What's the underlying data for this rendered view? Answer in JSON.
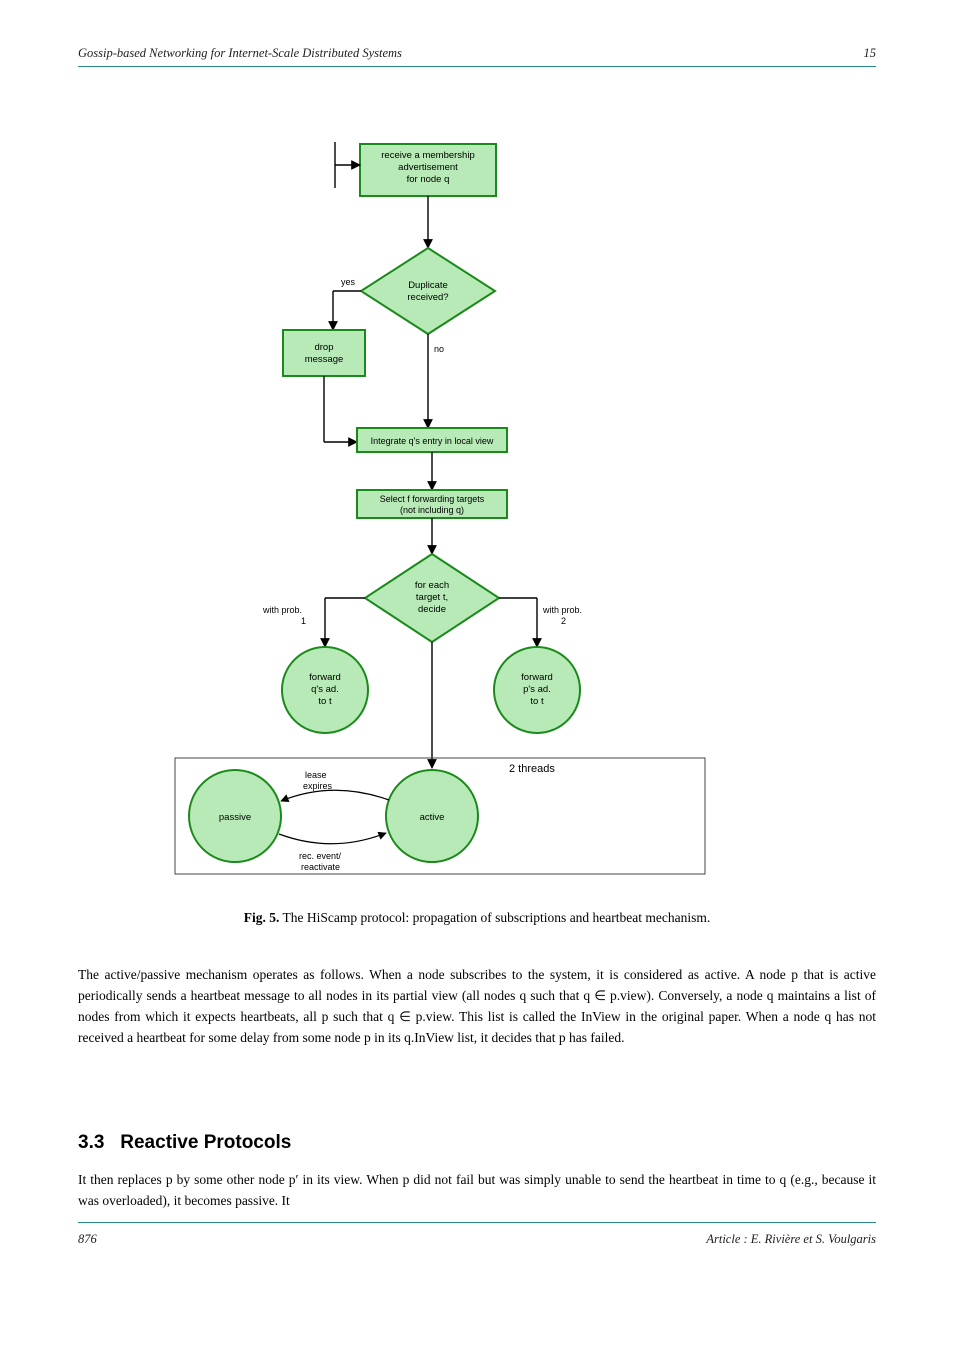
{
  "header": {
    "left": "Gossip-based Networking for Internet-Scale Distributed Systems",
    "right": "15"
  },
  "footer": {
    "left": "876",
    "right": "Article : E. Rivière et S. Voulgaris"
  },
  "figure": {
    "nodes": {
      "receive": "receive a membership\nadvertisement\nfor node q",
      "dup": "Duplicate\nreceived?",
      "drop": "drop\nmessage",
      "integrate": "Integrate q's entry in local view",
      "select": "Select f forwarding targets\n(not including q)",
      "decide": "for each\ntarget t,\ndecide",
      "fwd_q_1": "forward\nq's ad.\nto t",
      "fwd_p": "forward\np's ad.\nto t",
      "active": "active",
      "passive": "passive"
    },
    "edge_labels": {
      "dup_yes": "yes",
      "dup_no": "no",
      "prob1": "with prob.\n1",
      "prob2": "with prob.\n2",
      "threads": "2 threads",
      "lease": "lease\nexpires",
      "event": "rec. event/\nreactivate"
    },
    "caption": "Fig. 5. The HiScamp protocol: propagation of subscriptions and heartbeat mechanism."
  },
  "body": {
    "p1": "The active/passive mechanism operates as follows. When a node subscribes to the system, it is considered as active. A node p that is active periodically sends a heartbeat message to all nodes in its partial view (all nodes q such that q ∈ p.view). Conversely, a node q maintains a list of nodes from which it expects heartbeats, all p such that q ∈ p.view. This list is called the InView in the original paper. When a node q has not received a heartbeat for some delay from some node p in its q.InView list, it decides that p has failed.",
    "p2": "It then replaces p by some other node p′ in its view. When p did not fail but was simply unable to send the heartbeat in time to q (e.g., because it was overloaded), it becomes passive. It",
    "h1_num": "3.3",
    "h1_txt": "Reactive Protocols"
  }
}
